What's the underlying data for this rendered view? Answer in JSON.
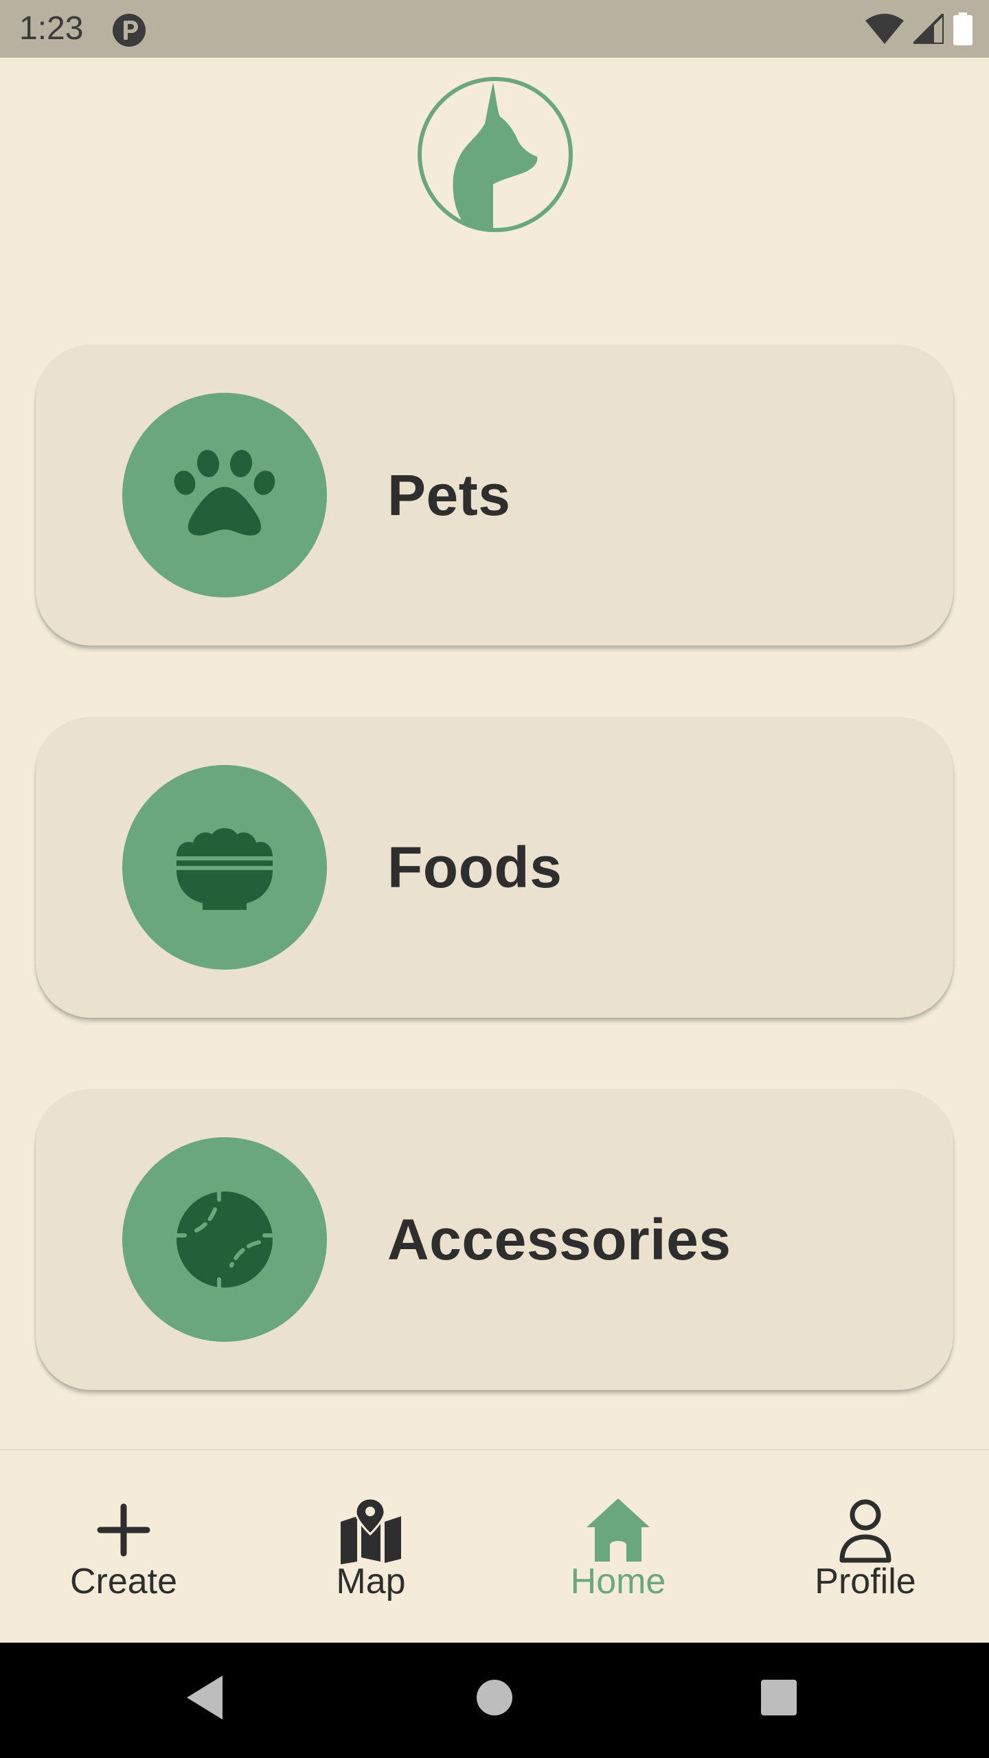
{
  "status_bar": {
    "time": "1:23",
    "app_icon": "circle-p-icon",
    "icons": [
      "wifi-icon",
      "signal-icon",
      "battery-icon"
    ]
  },
  "logo": {
    "icon": "cat-logo-icon"
  },
  "categories": [
    {
      "label": "Pets",
      "icon": "paw-icon"
    },
    {
      "label": "Foods",
      "icon": "food-bowl-icon"
    },
    {
      "label": "Accessories",
      "icon": "ball-icon"
    }
  ],
  "bottom_nav": {
    "items": [
      {
        "label": "Create",
        "icon": "plus-icon",
        "active": false
      },
      {
        "label": "Map",
        "icon": "map-icon",
        "active": false
      },
      {
        "label": "Home",
        "icon": "home-icon",
        "active": true
      },
      {
        "label": "Profile",
        "icon": "profile-icon",
        "active": false
      }
    ]
  },
  "system_nav": {
    "buttons": [
      "back-icon",
      "home-circle-icon",
      "recents-square-icon"
    ]
  },
  "colors": {
    "background": "#F4ECD9",
    "card": "#EAE2CE",
    "accent": "#6AA77C",
    "accent_dark": "#22603A",
    "text": "#2E2E2E",
    "status_bar": "#B8B1A0"
  }
}
